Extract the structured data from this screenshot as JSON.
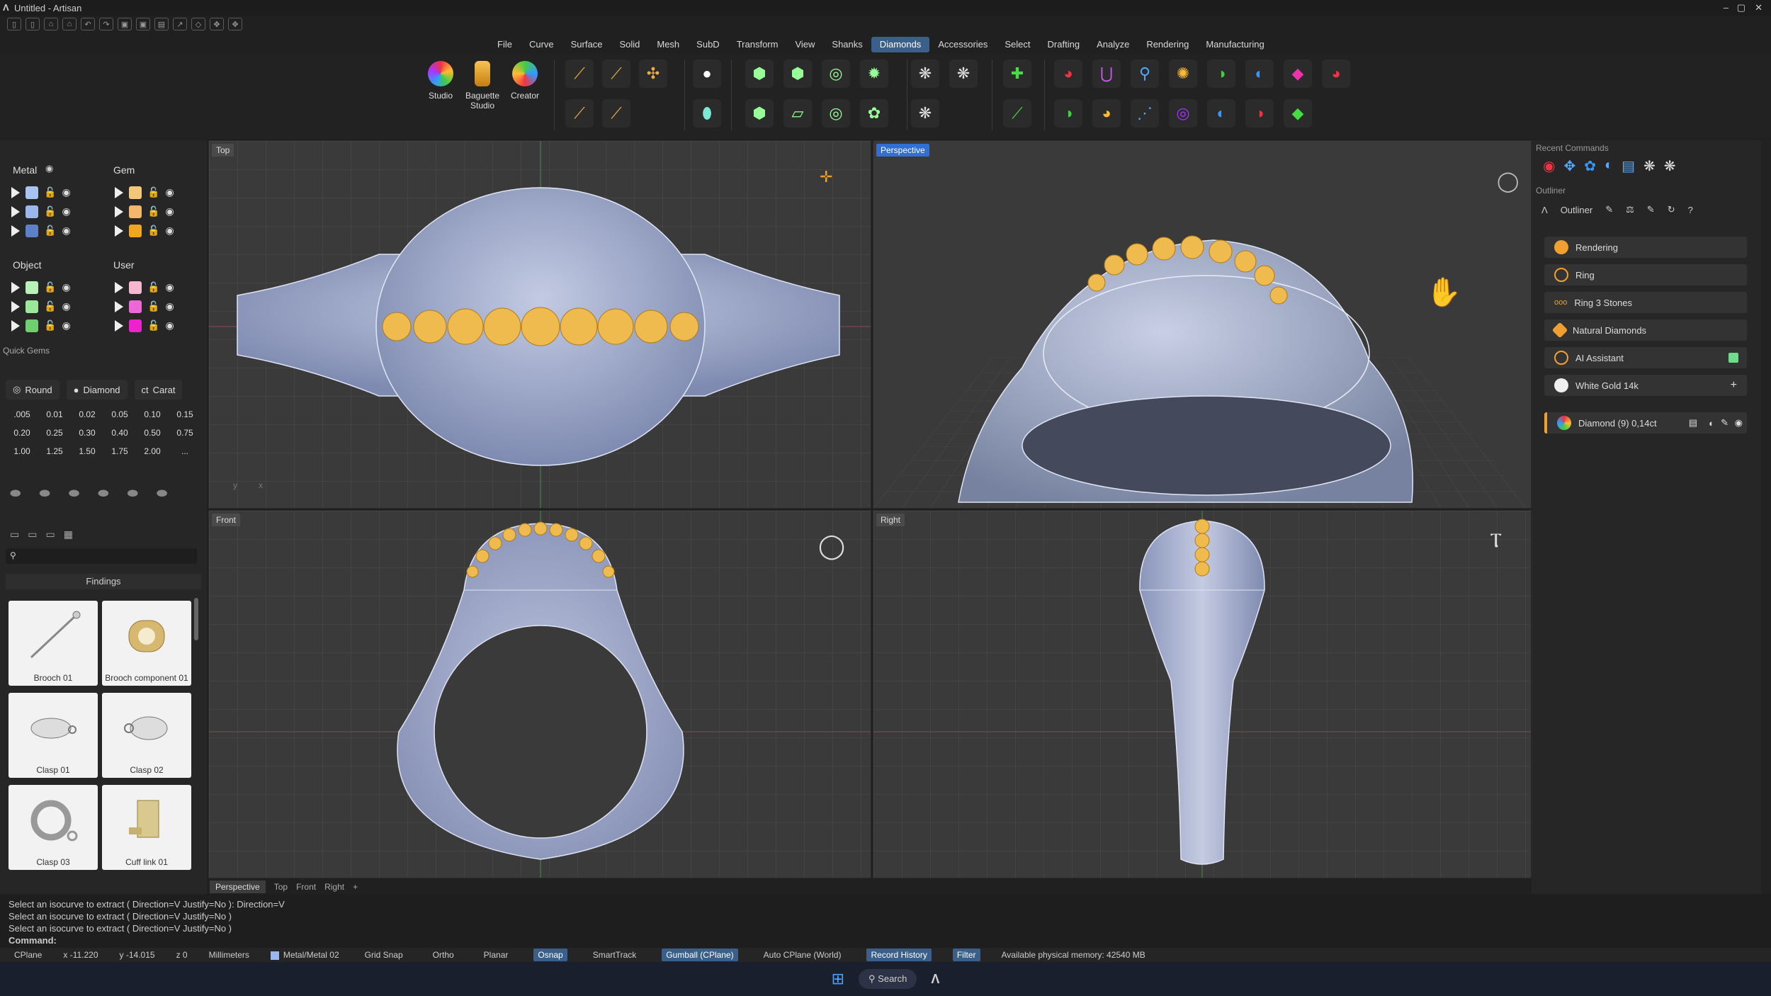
{
  "window": {
    "title": "Untitled - Artisan"
  },
  "menu": [
    "File",
    "Curve",
    "Surface",
    "Solid",
    "Mesh",
    "SubD",
    "Transform",
    "View",
    "Shanks",
    "Diamonds",
    "Accessories",
    "Select",
    "Drafting",
    "Analyze",
    "Rendering",
    "Manufacturing"
  ],
  "menu_active": "Diamonds",
  "ribbon": {
    "studio": "Studio",
    "baguette": "Baguette Studio",
    "creator": "Creator"
  },
  "layers": {
    "metal": {
      "title": "Metal",
      "colors": [
        "#a8c4f0",
        "#9bb8ec",
        "#5d80c8"
      ]
    },
    "gem": {
      "title": "Gem",
      "colors": [
        "#f3c77a",
        "#f3b66a",
        "#f2a521"
      ]
    },
    "object": {
      "title": "Object",
      "colors": [
        "#b8f2b8",
        "#9be89b",
        "#6fcf6f"
      ]
    },
    "user": {
      "title": "User",
      "colors": [
        "#f7b7cf",
        "#ef66d8",
        "#ee22cc"
      ]
    }
  },
  "quick_gems": {
    "title": "Quick Gems",
    "shape": "Round",
    "type": "Diamond",
    "unit": "Carat",
    "sizes": [
      ".005",
      "0.01",
      "0.02",
      "0.05",
      "0.10",
      "0.15",
      "0.20",
      "0.25",
      "0.30",
      "0.40",
      "0.50",
      "0.75",
      "1.00",
      "1.25",
      "1.50",
      "1.75",
      "2.00",
      "..."
    ]
  },
  "library": {
    "category": "Findings",
    "items": [
      "Brooch 01",
      "Brooch component 01",
      "Clasp 01",
      "Clasp 02",
      "Clasp 03",
      "Cuff link 01"
    ]
  },
  "viewports": {
    "top": "Top",
    "perspective": "Perspective",
    "front": "Front",
    "right": "Right"
  },
  "bottom_tabs": [
    "Perspective",
    "Top",
    "Front",
    "Right",
    "+"
  ],
  "recent_commands_title": "Recent Commands",
  "outliner": {
    "title": "Outliner",
    "items": [
      "Rendering",
      "Ring",
      "Ring 3 Stones",
      "Natural Diamonds",
      "AI Assistant",
      "White Gold 14k"
    ],
    "object": "Diamond (9) 0,14ct"
  },
  "command_history": [
    "Select an isocurve to extract ( Direction=V  Justify=No ): Direction=V",
    "Select an isocurve to extract ( Direction=V  Justify=No )",
    "Select an isocurve to extract ( Direction=V  Justify=No )"
  ],
  "command_prompt": "Command:",
  "status": {
    "cplane": "CPlane",
    "x": "x -11.220",
    "y": "y -14.015",
    "z": "z 0",
    "units": "Millimeters",
    "layer": "Metal/Metal 02",
    "grid_snap": "Grid Snap",
    "ortho": "Ortho",
    "planar": "Planar",
    "osnap": "Osnap",
    "smarttrack": "SmartTrack",
    "gumball": "Gumball (CPlane)",
    "auto_cplane": "Auto CPlane (World)",
    "record_history": "Record History",
    "filter": "Filter",
    "memory": "Available physical memory: 42540 MB"
  },
  "taskbar": {
    "search": "Search"
  },
  "colors": {
    "accent": "#3a5f8a",
    "gem": "#f2b24a",
    "metal": "#a9b5d6"
  }
}
